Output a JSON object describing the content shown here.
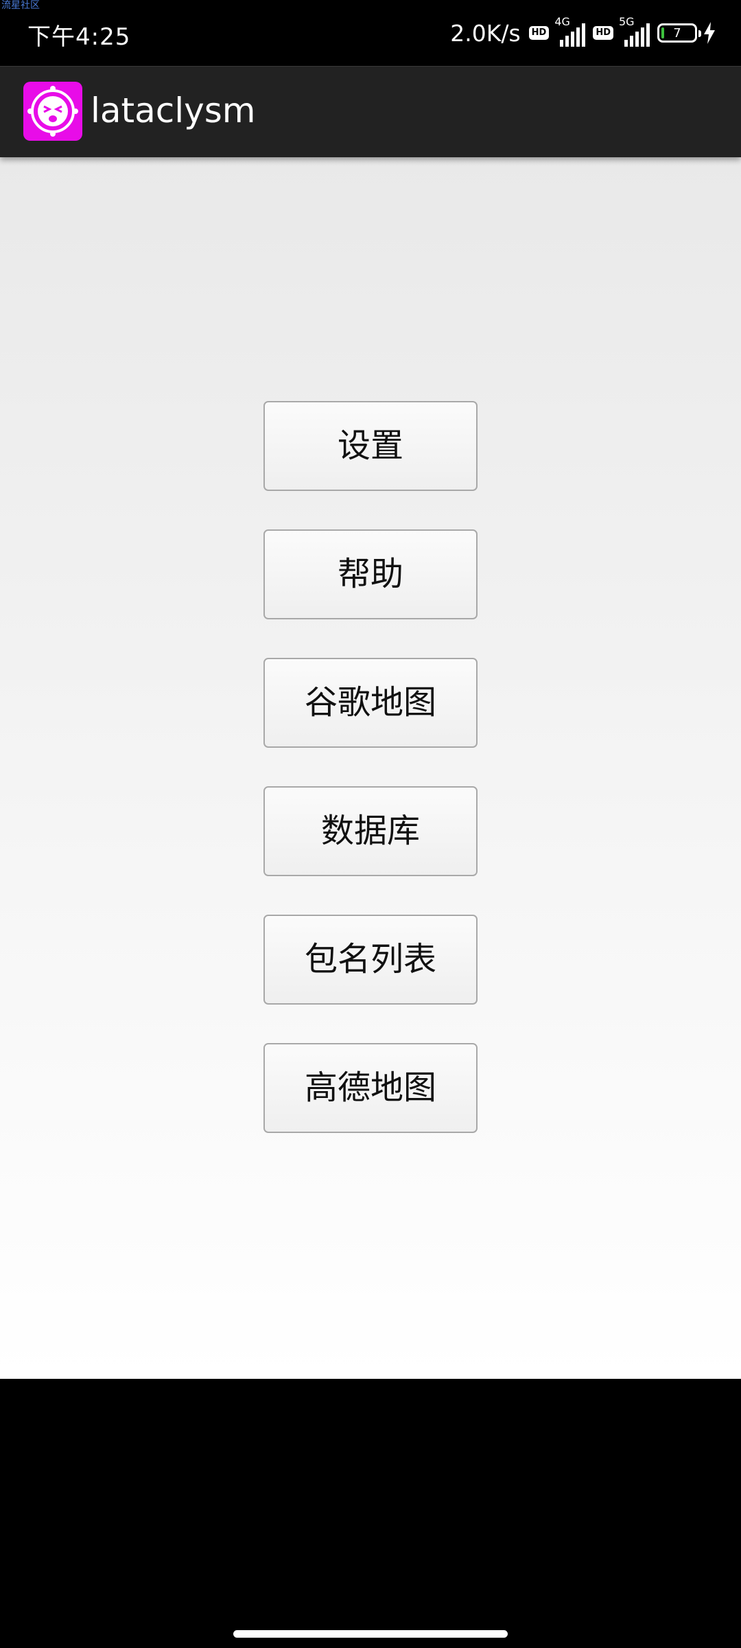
{
  "watermark": "流星社区",
  "status_bar": {
    "time": "下午4:25",
    "net_speed": "2.0K/s",
    "hd_badge": "HD",
    "signal_1_type": "4G",
    "signal_2_type": "5G",
    "battery_level": "7",
    "battery_color": "#3cc13c"
  },
  "action_bar": {
    "title": "lataclysm",
    "icon_color": "#e80ce8"
  },
  "menu": {
    "buttons": [
      {
        "label": "设置"
      },
      {
        "label": "帮助"
      },
      {
        "label": "谷歌地图"
      },
      {
        "label": "数据库"
      },
      {
        "label": "包名列表"
      },
      {
        "label": "高德地图"
      }
    ]
  }
}
